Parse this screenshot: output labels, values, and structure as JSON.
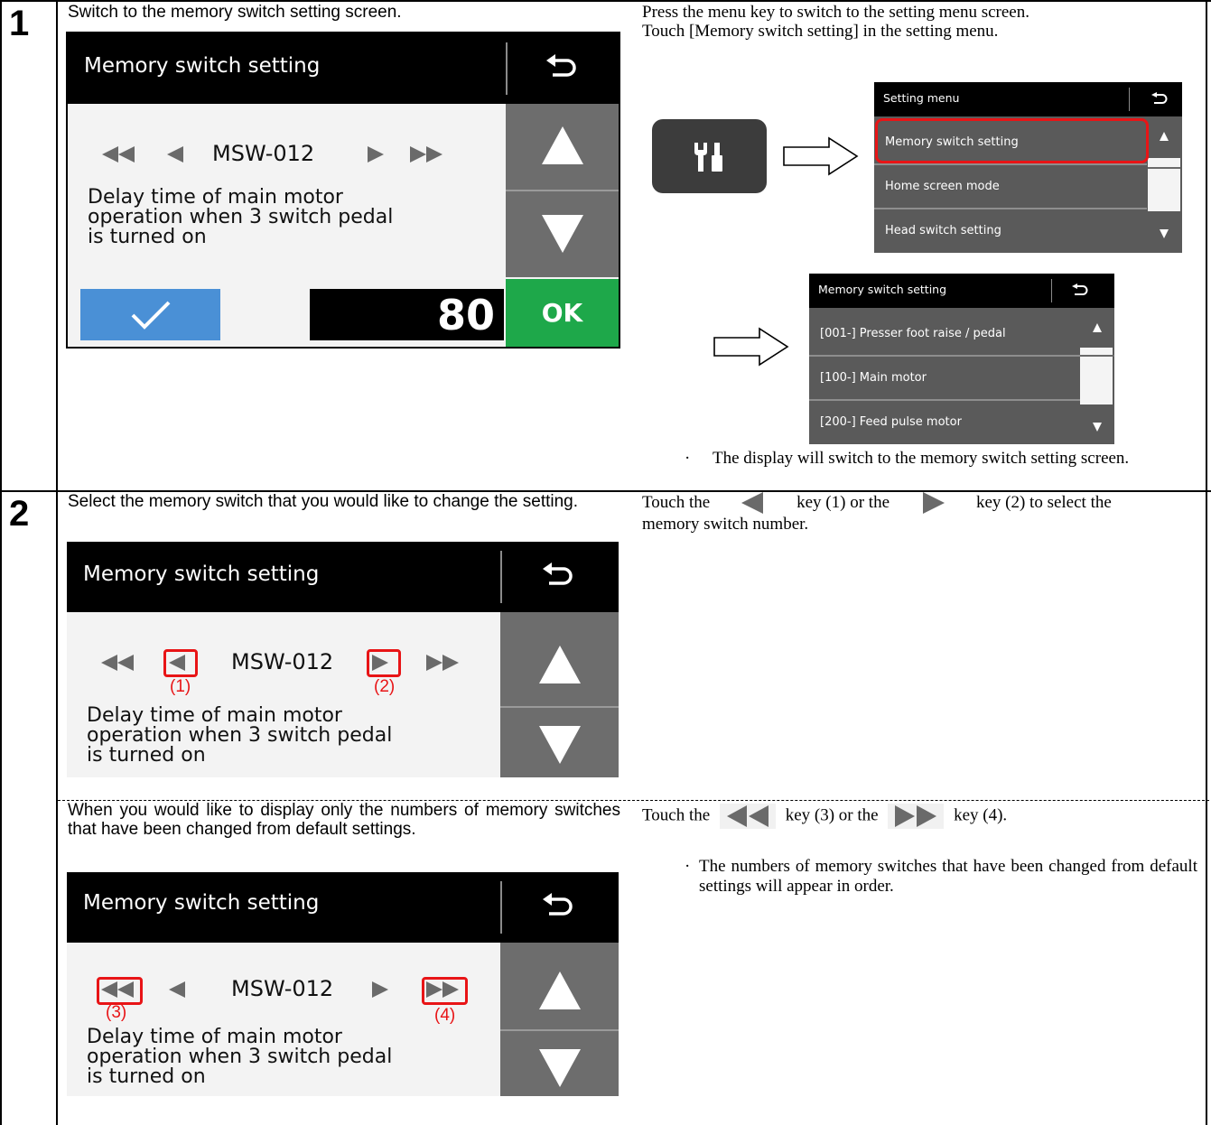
{
  "step1": {
    "number": "1",
    "left_heading": "Switch to the memory switch setting screen.",
    "right_line1": "Press the menu key to switch to the setting menu screen.",
    "right_line2": "Touch [Memory switch setting] in the setting menu.",
    "bullet": "·",
    "note": "The display will switch to the memory switch setting screen."
  },
  "step2": {
    "number": "2",
    "left_heading": "Select the memory switch that you would like to change the setting.",
    "right_pre": "Touch the",
    "right_mid1": "key (1) or the",
    "right_mid2": "key (2) to select the memory switch number.",
    "sub_heading": "When you would like to display only the numbers of memory switches that have been changed from default settings.",
    "sub_right_pre": "Touch the",
    "sub_right_mid": "key (3) or the",
    "sub_right_post": "key (4).",
    "bullet": "·",
    "sub_note": "The numbers of memory switches that have been changed from default settings will appear in order."
  },
  "device": {
    "title": "Memory switch setting",
    "msw": "MSW-012",
    "description": [
      "Delay time of main motor",
      "operation when 3 switch pedal",
      "is turned on"
    ],
    "value": "80",
    "ok": "OK",
    "labels": {
      "l1": "(1)",
      "l2": "(2)",
      "l3": "(3)",
      "l4": "(4)"
    }
  },
  "setting_menu": {
    "title": "Setting menu",
    "items": [
      "Memory switch setting",
      "Home screen mode",
      "Head switch setting"
    ]
  },
  "memory_menu": {
    "title": "Memory switch setting",
    "items": [
      "[001-] Presser foot raise / pedal",
      "[100-] Main motor",
      "[200-] Feed pulse motor"
    ]
  },
  "colors": {
    "highlight": "#e81416",
    "confirm_blue": "#4a90d6",
    "ok_green": "#1ea84a"
  },
  "icons": [
    "back-arrow-icon",
    "fast-backward-icon",
    "backward-icon",
    "forward-icon",
    "fast-forward-icon",
    "scroll-up-icon",
    "scroll-down-icon",
    "checkmark-icon",
    "wrench-screwdriver-icon",
    "hollow-right-arrow-icon"
  ]
}
